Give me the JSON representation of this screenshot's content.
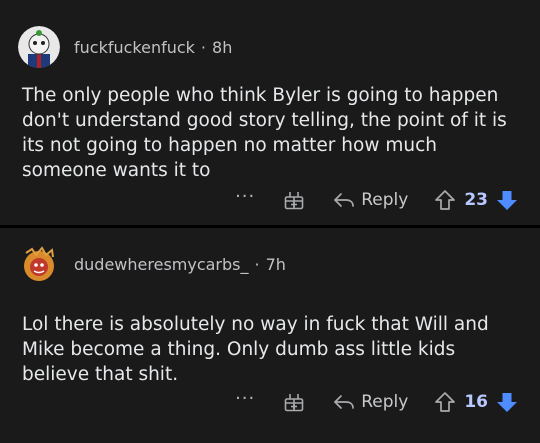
{
  "comments": [
    {
      "username": "fuckfuckenfuck",
      "separator": "·",
      "age": "8h",
      "body": "The only people who think Byler is going to happen don't understand good story telling, the point of it is its not going to happen no matter how much someone wants it to",
      "more_label": "···",
      "reply_label": "Reply",
      "score": "23"
    },
    {
      "username": "dudewheresmycarbs_",
      "separator": "·",
      "age": "7h",
      "body": "Lol there is absolutely no way in fuck that Will and Mike become a thing. Only dumb ass little kids believe that shit.",
      "more_label": "···",
      "reply_label": "Reply",
      "score": "16"
    }
  ],
  "colors": {
    "background": "#000000",
    "card": "#1a1a1b",
    "score": "#b8c8ff",
    "downvote": "#4f8cff",
    "avatar1_bg": "#e8e8e8",
    "avatar2_bg": "#d98a2b"
  },
  "icons": {
    "award": "gift-icon",
    "reply": "reply-arrow-icon",
    "upvote": "upvote-arrow-icon",
    "downvote": "downvote-arrow-icon"
  }
}
